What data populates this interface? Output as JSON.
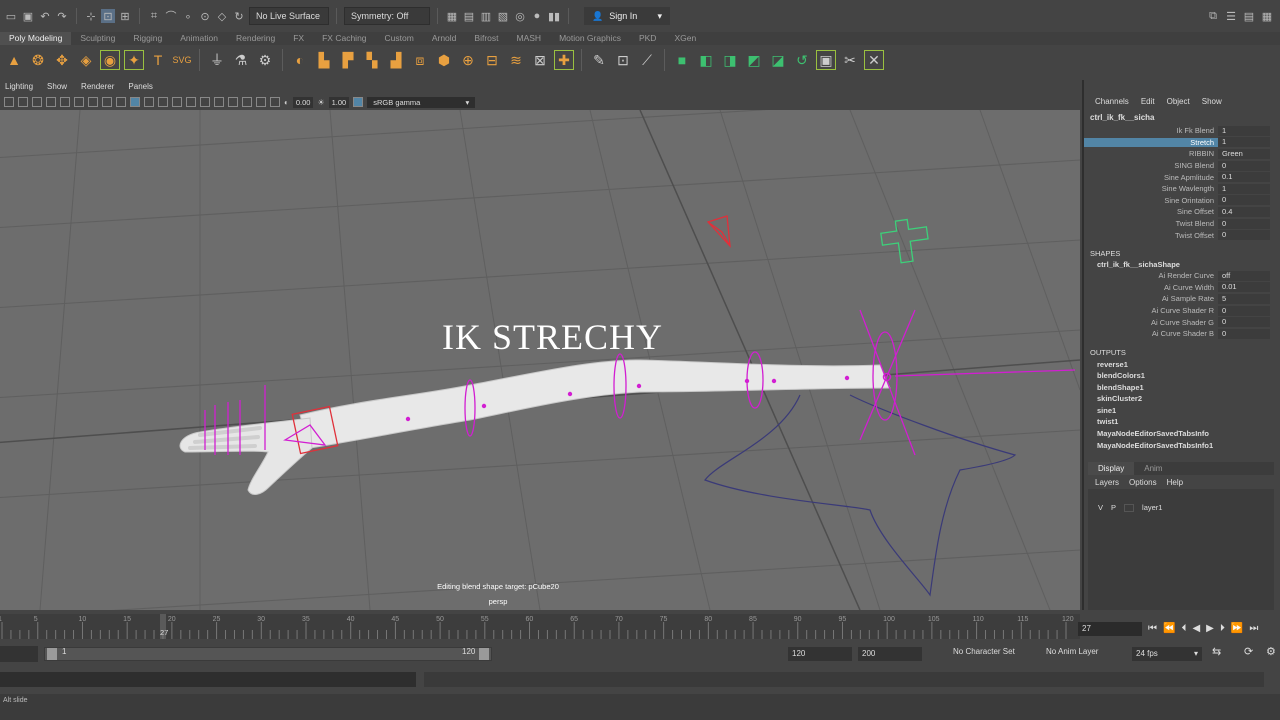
{
  "topbar": {
    "live_surface": "No Live Surface",
    "symmetry": "Symmetry: Off",
    "sign_in": "Sign In"
  },
  "shelf_tabs": [
    "Poly Modeling",
    "Sculpting",
    "Rigging",
    "Animation",
    "Rendering",
    "FX",
    "FX Caching",
    "Custom",
    "Arnold",
    "Bifrost",
    "MASH",
    "Motion Graphics",
    "PKD",
    "XGen"
  ],
  "viewport": {
    "menu": [
      "Lighting",
      "Show",
      "Renderer",
      "Panels"
    ],
    "exposure": "0.00",
    "gamma_value": "1.00",
    "color_space": "sRGB gamma",
    "title": "IK STRECHY",
    "caption": "Editing blend shape target: pCube20",
    "camera": "persp"
  },
  "channel_box": {
    "menu": [
      "Channels",
      "Edit",
      "Object",
      "Show"
    ],
    "node": "ctrl_ik_fk__sicha",
    "attributes": [
      {
        "name": "Ik Fk Blend",
        "value": "1"
      },
      {
        "name": "Stretch",
        "value": "1"
      },
      {
        "name": "RIBBIN",
        "value": "Green"
      },
      {
        "name": "SING Blend",
        "value": "0"
      },
      {
        "name": "Sine Apmlitude",
        "value": "0.1"
      },
      {
        "name": "Sine Wavlength",
        "value": "1"
      },
      {
        "name": "Sine Orintation",
        "value": "0"
      },
      {
        "name": "Sine Offset",
        "value": "0.4"
      },
      {
        "name": "Twist Blend",
        "value": "0"
      },
      {
        "name": "Twist Offset",
        "value": "0"
      }
    ],
    "shapes_label": "SHAPES",
    "shape_node": "ctrl_ik_fk__sichaShape",
    "shape_attributes": [
      {
        "name": "Ai Render Curve",
        "value": "off"
      },
      {
        "name": "Ai Curve Width",
        "value": "0.01"
      },
      {
        "name": "Ai Sample Rate",
        "value": "5"
      },
      {
        "name": "Ai Curve Shader R",
        "value": "0"
      },
      {
        "name": "Ai Curve Shader G",
        "value": "0"
      },
      {
        "name": "Ai Curve Shader B",
        "value": "0"
      }
    ],
    "outputs_label": "OUTPUTS",
    "outputs": [
      "reverse1",
      "blendColors1",
      "blendShape1",
      "skinCluster2",
      "sine1",
      "twist1",
      "MayaNodeEditorSavedTabsInfo",
      "MayaNodeEditorSavedTabsInfo1"
    ]
  },
  "layer_editor": {
    "tabs": [
      "Display",
      "Anim"
    ],
    "menu": [
      "Layers",
      "Options",
      "Help"
    ],
    "visibility": "V",
    "playback": "P",
    "layer_name": "layer1"
  },
  "timeline": {
    "ticks": [
      "1",
      "5",
      "10",
      "15",
      "20",
      "25",
      "30",
      "35",
      "40",
      "45",
      "50",
      "55",
      "60",
      "65",
      "70",
      "75",
      "80",
      "85",
      "90",
      "95",
      "100",
      "105",
      "110",
      "115",
      "120"
    ],
    "current_frame": "27",
    "frame_field": "27"
  },
  "range": {
    "slider_start": "1",
    "slider_end": "120",
    "anim_end": "120",
    "playback_end": "200",
    "character_set": "No Character Set",
    "anim_layer": "No Anim Layer",
    "fps": "24 fps"
  },
  "helpline": "Alt slide",
  "colors": {
    "viewport_bg": "#6d6d6d",
    "rig_magenta": "#d21ed2",
    "selected_attr": "#5285a6",
    "green_control": "#3dd07a",
    "red_control": "#e0303a",
    "curve_purple": "#3a3a78"
  }
}
